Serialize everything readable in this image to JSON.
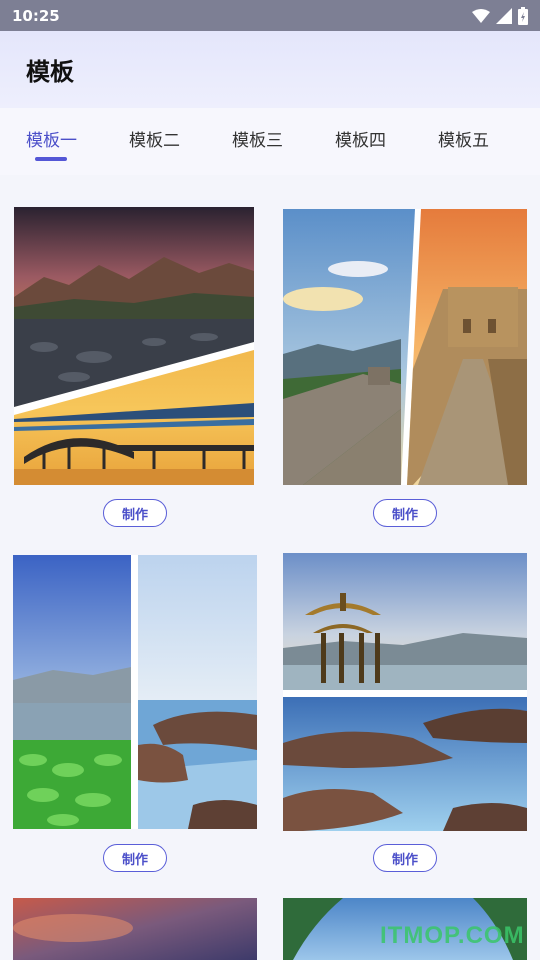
{
  "status_bar": {
    "time": "10:25",
    "icons": [
      "wifi-icon",
      "signal-icon",
      "battery-icon"
    ]
  },
  "header": {
    "title": "模板"
  },
  "tabs": [
    {
      "label": "模板一",
      "active": true
    },
    {
      "label": "模板二",
      "active": false
    },
    {
      "label": "模板三",
      "active": false
    },
    {
      "label": "模板四",
      "active": false
    },
    {
      "label": "模板五",
      "active": false
    }
  ],
  "templates": [
    {
      "button_label": "制作"
    },
    {
      "button_label": "制作"
    },
    {
      "button_label": "制作"
    },
    {
      "button_label": "制作"
    }
  ],
  "watermark": "ITMOP.COM",
  "colors": {
    "accent": "#5457d6",
    "header_bg": "#e4e6fb",
    "status_bar": "#7d7f94"
  }
}
